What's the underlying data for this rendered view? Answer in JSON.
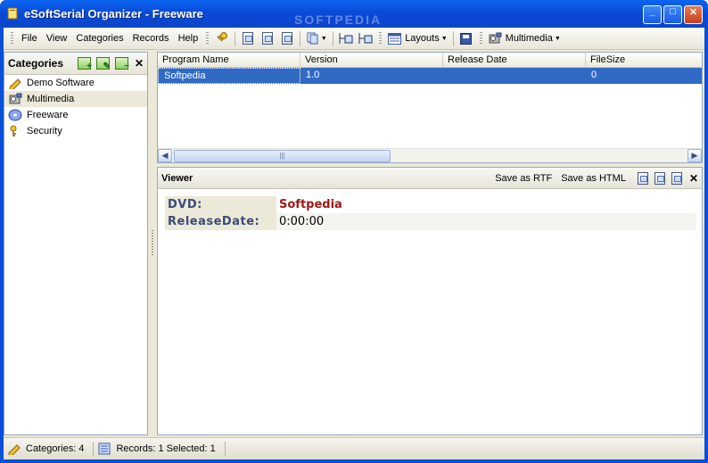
{
  "window": {
    "title": "eSoftSerial Organizer - Freeware",
    "watermark": "SOFTPEDIA",
    "min_label": "_",
    "max_label": "□",
    "close_label": "✕"
  },
  "menu": [
    "File",
    "View",
    "Categories",
    "Records",
    "Help"
  ],
  "toolbar": {
    "layouts_label": "Layouts",
    "multimedia_label": "Multimedia"
  },
  "categories": {
    "title": "Categories",
    "items": [
      {
        "label": "Demo Software",
        "icon": "pencil-icon"
      },
      {
        "label": "Multimedia",
        "icon": "media-icon"
      },
      {
        "label": "Freeware",
        "icon": "disc-icon"
      },
      {
        "label": "Security",
        "icon": "keys-icon"
      }
    ],
    "selected": "Multimedia",
    "close_label": "✕"
  },
  "grid": {
    "columns": [
      "Program Name",
      "Version",
      "Release Date",
      "FileSize"
    ],
    "rows": [
      [
        "Softpedia",
        "1.0",
        "",
        "0"
      ]
    ]
  },
  "viewer": {
    "title": "Viewer",
    "save_rtf": "Save as RTF",
    "save_html": "Save as HTML",
    "close_label": "✕",
    "fields": [
      {
        "key": "DVD:",
        "value": "Softpedia"
      },
      {
        "key": "ReleaseDate:",
        "value": "0:00:00"
      }
    ]
  },
  "status": {
    "categories": "Categories: 4",
    "records": "Records: 1  Selected: 1"
  },
  "colors": {
    "selection": "#316ac5",
    "titlebar": "#0a4fd8",
    "value_red": "#a01818"
  }
}
